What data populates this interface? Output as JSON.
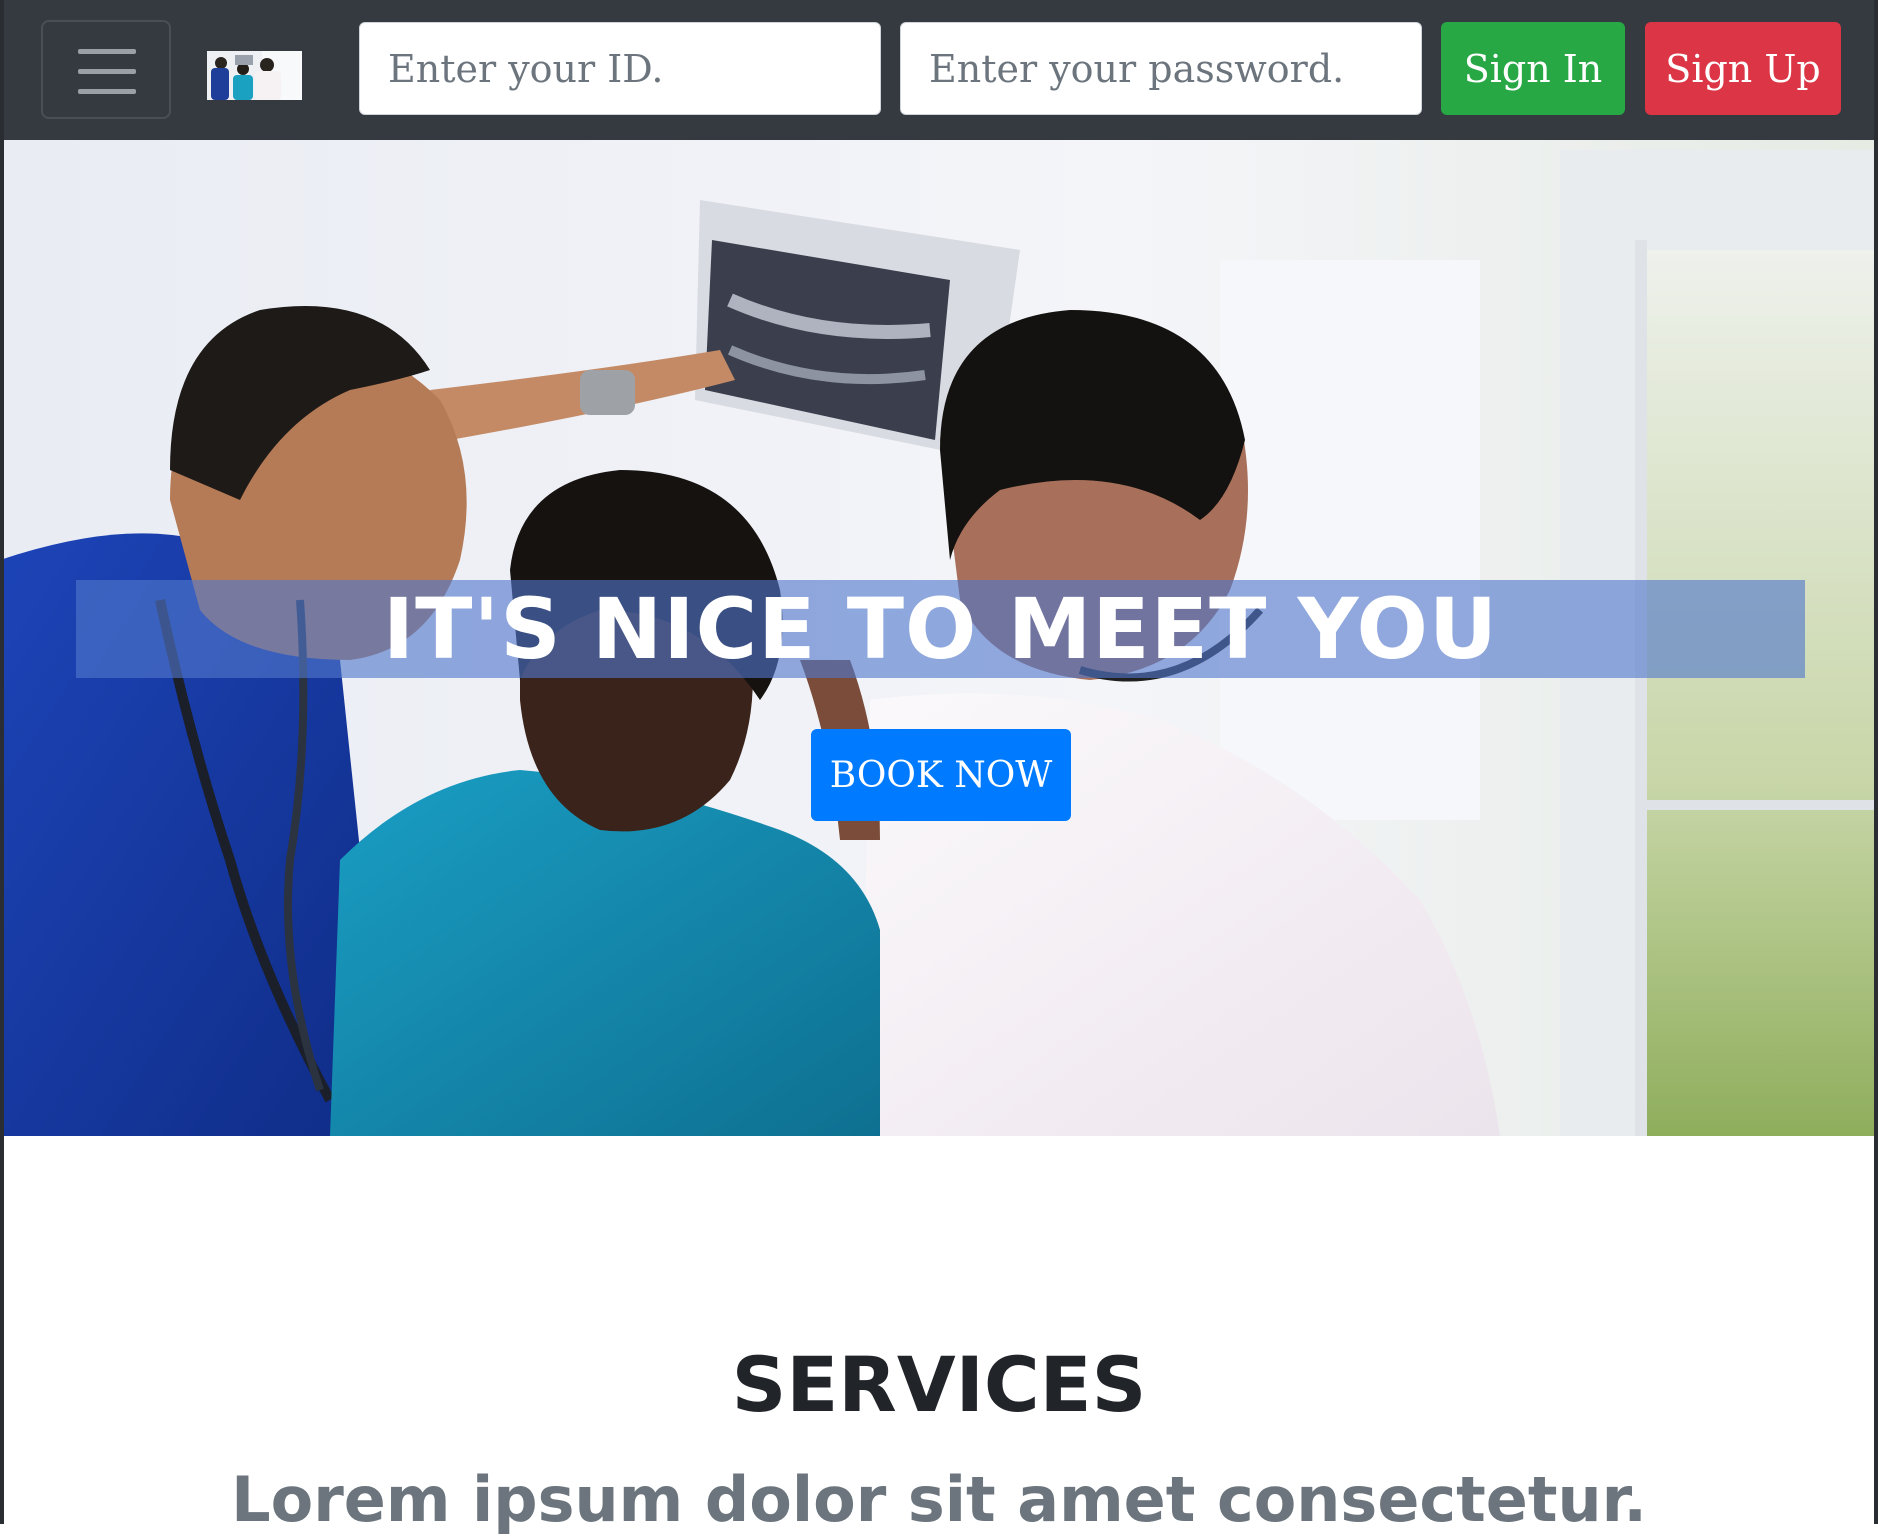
{
  "navbar": {
    "brand_alt": "logo",
    "id_input": {
      "placeholder": "Enter your ID.",
      "value": ""
    },
    "password_input": {
      "placeholder": "Enter your password.",
      "value": ""
    },
    "sign_in_label": "Sign In",
    "sign_up_label": "Sign Up"
  },
  "hero": {
    "headline": "IT'S NICE TO MEET YOU",
    "cta_label": "BOOK NOW"
  },
  "services": {
    "title": "SERVICES",
    "subtitle": "Lorem ipsum dolor sit amet consectetur."
  },
  "colors": {
    "navbar_bg": "#343a40",
    "sign_in": "#28a745",
    "sign_up": "#dc3545",
    "cta": "#007bff",
    "headline_band": "#5178cc"
  }
}
